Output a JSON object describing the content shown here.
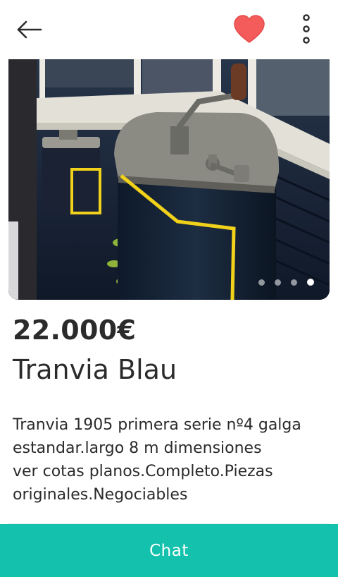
{
  "header": {
    "back_icon": "arrow-left-icon",
    "favorite_icon": "heart-icon",
    "more_icon": "vertical-dots-icon",
    "favorite_color": "#f45c5c"
  },
  "gallery": {
    "image_count": 4,
    "active_index": 3
  },
  "listing": {
    "price": "22.000€",
    "title": "Tranvia Blau",
    "description_lines": [
      "Tranvia 1905 primera serie nº4 galga",
      "estandar.largo 8 m dimensiones",
      "ver cotas planos.Completo.Piezas",
      "originales.Negociables"
    ]
  },
  "actions": {
    "chat_label": "Chat",
    "chat_color": "#13c1ac"
  }
}
